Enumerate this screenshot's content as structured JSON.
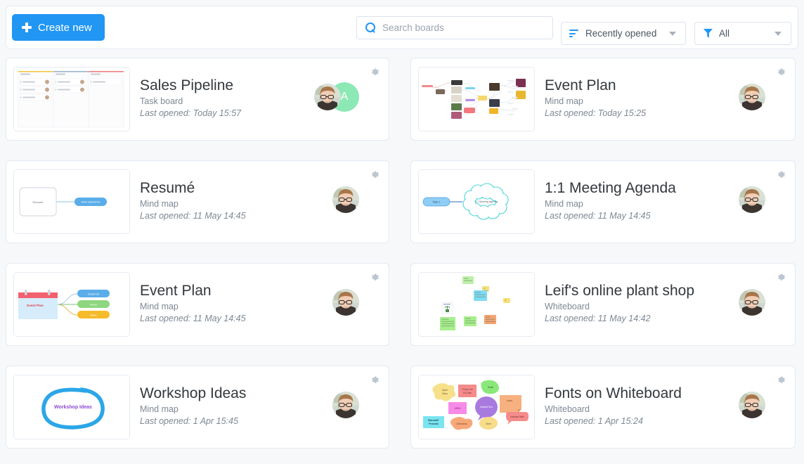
{
  "toolbar": {
    "create_label": "Create new",
    "create_icon": "plus-icon",
    "search_placeholder": "Search boards",
    "search_value": "",
    "search_icon": "search-icon",
    "sort_label": "Recently opened",
    "sort_icon": "sort-icon",
    "filter_label": "All",
    "filter_icon": "funnel-icon",
    "caret_icon": "chevron-down-icon"
  },
  "colors": {
    "accent": "#2196f3",
    "page_bg": "#f7f8fa",
    "card_bg": "#ffffff",
    "card_border": "#e3eaf2",
    "title": "#33383d",
    "meta": "#7d8894",
    "avatar_initial_bg": "#8ce8b4"
  },
  "boards": [
    {
      "title": "Sales Pipeline",
      "type": "Task board",
      "date": "Last opened: Today 15:57",
      "thumb": "kanban",
      "gear_icon": "gear-icon",
      "avatars": [
        {
          "kind": "photo"
        },
        {
          "kind": "initial",
          "letter": "A"
        }
      ]
    },
    {
      "title": "Event Plan",
      "type": "Mind map",
      "date": "Last opened: Today 15:25",
      "thumb": "mindmap-photos",
      "gear_icon": "gear-icon",
      "avatars": [
        {
          "kind": "photo"
        }
      ]
    },
    {
      "title": "Resumé",
      "type": "Mind map",
      "date": "Last opened: 11 May 14:45",
      "thumb": "resume",
      "thumb_labels": {
        "root": "Resumé",
        "node": "Work experience"
      },
      "gear_icon": "gear-icon",
      "avatars": [
        {
          "kind": "photo"
        }
      ]
    },
    {
      "title": "1:1 Meeting Agenda",
      "type": "Mind map",
      "date": "Last opened: 11 May 14:45",
      "thumb": "cloud",
      "thumb_labels": {
        "pill": "Task 1",
        "cloud": "1:1 Meeting Agenda"
      },
      "gear_icon": "gear-icon",
      "avatars": [
        {
          "kind": "photo"
        }
      ]
    },
    {
      "title": "Event Plan",
      "type": "Mind map",
      "date": "Last opened: 11 May 14:45",
      "thumb": "calendar",
      "thumb_labels": {
        "root": "Event Plan",
        "n1": "Guest List",
        "n2": "Venue",
        "n3": "Menu"
      },
      "gear_icon": "gear-icon",
      "avatars": [
        {
          "kind": "photo"
        }
      ]
    },
    {
      "title": "Leif's online plant shop",
      "type": "Whiteboard",
      "date": "Last opened: 11 May 14:42",
      "thumb": "stickies-plant",
      "gear_icon": "gear-icon",
      "avatars": [
        {
          "kind": "photo"
        }
      ]
    },
    {
      "title": "Workshop Ideas",
      "type": "Mind map",
      "date": "Last opened: 1 Apr 15:45",
      "thumb": "ellipse",
      "thumb_labels": {
        "label": "Workshop Ideas"
      },
      "gear_icon": "gear-icon",
      "avatars": [
        {
          "kind": "photo"
        }
      ]
    },
    {
      "title": "Fonts on Whiteboard",
      "type": "Whiteboard",
      "date": "Last opened: 1 Apr 15:24",
      "thumb": "stickies-fonts",
      "gear_icon": "gear-icon",
      "avatars": [
        {
          "kind": "photo"
        }
      ]
    }
  ]
}
